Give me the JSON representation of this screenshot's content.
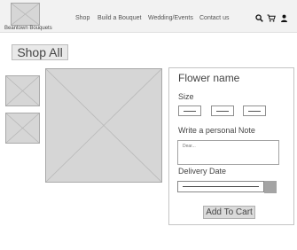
{
  "header": {
    "brand": "Beantown Bouquets",
    "nav": [
      "Shop",
      "Build a Bouquet",
      "Wedding/Events",
      "Contact us"
    ],
    "icons": [
      "search-icon",
      "cart-icon",
      "user-icon"
    ]
  },
  "page": {
    "shop_all": "Shop All"
  },
  "product": {
    "name": "Flower name",
    "size_label": "Size",
    "note_label": "Write a personal Note",
    "note_placeholder": "Dear...",
    "delivery_label": "Delivery Date",
    "add_to_cart": "Add To Cart"
  }
}
